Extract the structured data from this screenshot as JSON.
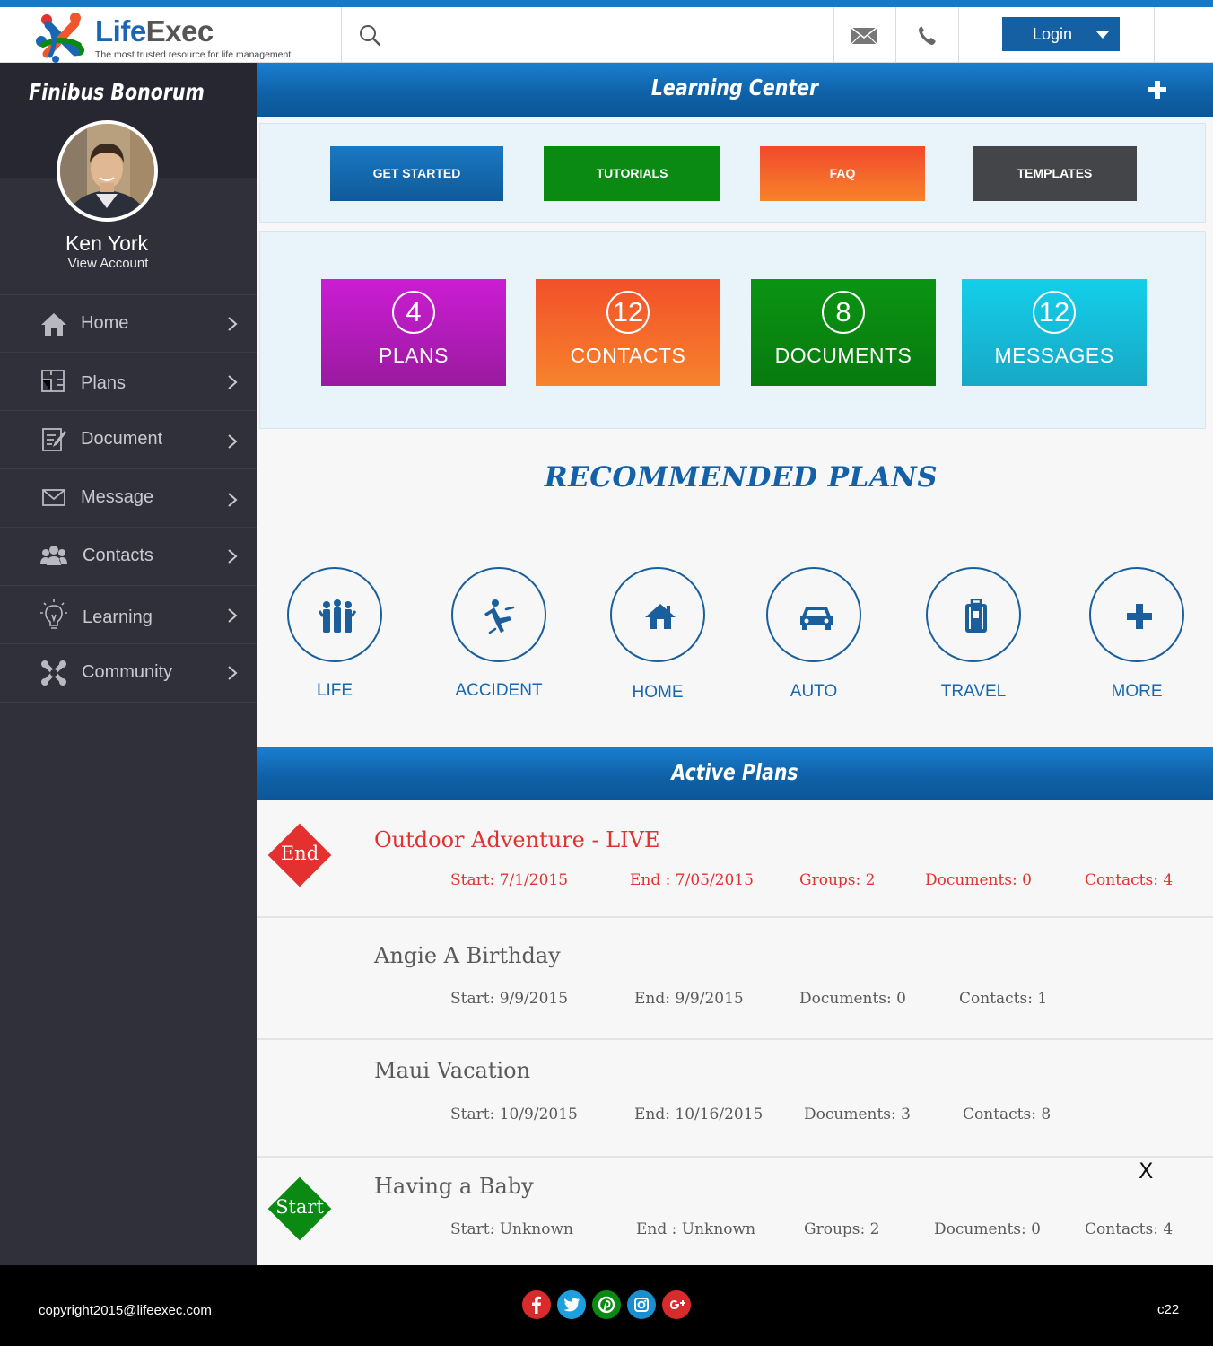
{
  "header": {
    "brand_part1": "Life",
    "brand_part2": "Exec",
    "tagline": "The most trusted resource for life management",
    "search_placeholder": "",
    "login_label": "Login"
  },
  "sidebar": {
    "title": "Finibus Bonorum",
    "user_name": "Ken York",
    "view_account": "View Account",
    "items": [
      {
        "label": "Home",
        "icon": "home-icon"
      },
      {
        "label": "Plans",
        "icon": "plans-icon"
      },
      {
        "label": "Document",
        "icon": "document-icon"
      },
      {
        "label": "Message",
        "icon": "message-icon"
      },
      {
        "label": "Contacts",
        "icon": "contacts-icon"
      },
      {
        "label": "Learning",
        "icon": "lightbulb-icon"
      },
      {
        "label": "Community",
        "icon": "community-icon"
      }
    ]
  },
  "learning_center": {
    "title": "Learning Center",
    "buttons": [
      {
        "label": "GET STARTED",
        "color": "#1563a8"
      },
      {
        "label": "TUTORIALS",
        "color": "#0a8a12"
      },
      {
        "label": "FAQ",
        "color": "#f2542b"
      },
      {
        "label": "TEMPLATES",
        "color": "#444548"
      }
    ]
  },
  "stats": [
    {
      "count": "4",
      "label": "PLANS",
      "color": "#b51bbf"
    },
    {
      "count": "12",
      "label": "CONTACTS",
      "color": "#f4632a"
    },
    {
      "count": "8",
      "label": "DOCUMENTS",
      "color": "#0a8a12"
    },
    {
      "count": "12",
      "label": "MESSAGES",
      "color": "#1ab8d8"
    }
  ],
  "recommended": {
    "title": "RECOMMENDED PLANS",
    "items": [
      {
        "label": "LIFE",
        "icon": "family-icon"
      },
      {
        "label": "ACCIDENT",
        "icon": "accident-icon"
      },
      {
        "label": "HOME",
        "icon": "house-icon"
      },
      {
        "label": "AUTO",
        "icon": "car-icon"
      },
      {
        "label": "TRAVEL",
        "icon": "luggage-icon"
      },
      {
        "label": "MORE",
        "icon": "plus-icon"
      }
    ]
  },
  "active_plans": {
    "title": "Active Plans",
    "plans": [
      {
        "name": "Outdoor Adventure - LIVE",
        "badge": "End",
        "badge_color": "#e4302f",
        "start": "Start: 7/1/2015",
        "end": "End : 7/05/2015",
        "groups": "Groups: 2",
        "documents": "Documents: 0",
        "contacts": "Contacts: 4"
      },
      {
        "name": "Angie A Birthday",
        "start": "Start: 9/9/2015",
        "end": "End: 9/9/2015",
        "documents": "Documents: 0",
        "contacts": "Contacts: 1"
      },
      {
        "name": "Maui Vacation",
        "start": "Start: 10/9/2015",
        "end": "End: 10/16/2015",
        "documents": "Documents: 3",
        "contacts": "Contacts: 8"
      },
      {
        "name": "Having a Baby",
        "badge": "Start",
        "badge_color": "#0a8a12",
        "start": "Start: Unknown",
        "end": "End : Unknown",
        "groups": "Groups: 2",
        "documents": "Documents: 0",
        "contacts": "Contacts: 4",
        "close_label": "X"
      }
    ]
  },
  "footer": {
    "copyright": "copyright2015@lifeexec.com",
    "code": "c22",
    "social": [
      {
        "name": "facebook-icon",
        "glyph": "f",
        "color": "#d92b2b"
      },
      {
        "name": "twitter-icon",
        "glyph": "t",
        "color": "#1d9fe0"
      },
      {
        "name": "pinterest-icon",
        "glyph": "p",
        "color": "#0a8a12"
      },
      {
        "name": "instagram-icon",
        "glyph": "i",
        "color": "#1a8fd0"
      },
      {
        "name": "google-plus-icon",
        "glyph": "g+",
        "color": "#d92b2b"
      }
    ]
  }
}
